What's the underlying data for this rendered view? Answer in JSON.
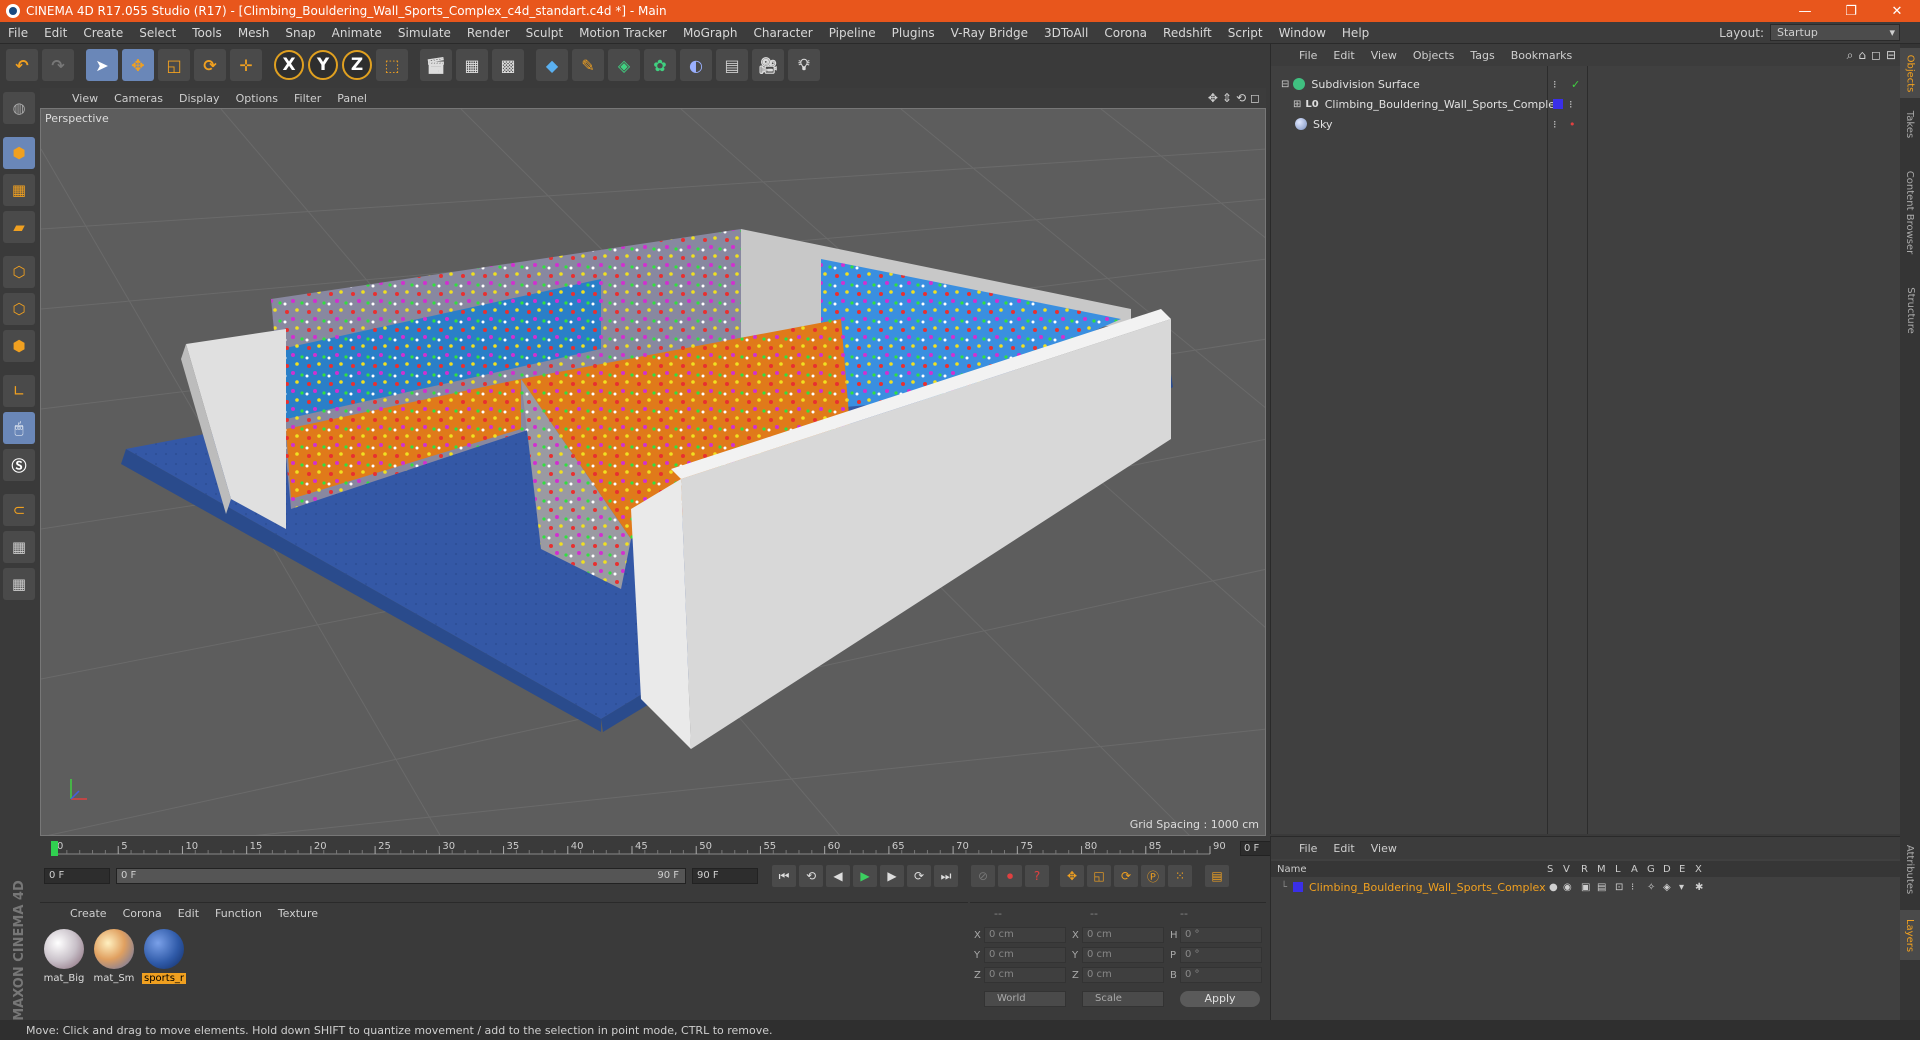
{
  "titlebar": {
    "title": "CINEMA 4D R17.055 Studio (R17) - [Climbing_Bouldering_Wall_Sports_Complex_c4d_standart.c4d *] - Main",
    "minimize": "—",
    "restore": "❐",
    "close": "✕"
  },
  "menu": [
    "File",
    "Edit",
    "Create",
    "Select",
    "Tools",
    "Mesh",
    "Snap",
    "Animate",
    "Simulate",
    "Render",
    "Sculpt",
    "Motion Tracker",
    "MoGraph",
    "Character",
    "Pipeline",
    "Plugins",
    "V-Ray Bridge",
    "3DToAll",
    "Corona",
    "Redshift",
    "Script",
    "Window",
    "Help"
  ],
  "layout": {
    "label": "Layout:",
    "value": "Startup"
  },
  "viewport": {
    "menu": [
      "View",
      "Cameras",
      "Display",
      "Options",
      "Filter",
      "Panel"
    ],
    "label": "Perspective",
    "grid_spacing": "Grid Spacing : 1000 cm"
  },
  "timeline": {
    "ticks": [
      "0",
      "5",
      "10",
      "15",
      "20",
      "25",
      "30",
      "35",
      "40",
      "45",
      "50",
      "55",
      "60",
      "65",
      "70",
      "75",
      "80",
      "85",
      "90"
    ],
    "end_field": "0 F",
    "start": "0 F",
    "range_start": "0 F",
    "range_end": "90 F",
    "end": "90 F"
  },
  "material_manager": {
    "menu": [
      "Create",
      "Corona",
      "Edit",
      "Function",
      "Texture"
    ],
    "materials": [
      {
        "name": "mat_Big"
      },
      {
        "name": "mat_Sm"
      },
      {
        "name": "sports_r"
      }
    ]
  },
  "coordinates": {
    "header": [
      "--",
      "--",
      "--"
    ],
    "rows": [
      {
        "a1": "X",
        "v1": "0 cm",
        "a2": "X",
        "v2": "0 cm",
        "a3": "H",
        "v3": "0 °"
      },
      {
        "a1": "Y",
        "v1": "0 cm",
        "a2": "Y",
        "v2": "0 cm",
        "a3": "P",
        "v3": "0 °"
      },
      {
        "a1": "Z",
        "v1": "0 cm",
        "a2": "Z",
        "v2": "0 cm",
        "a3": "B",
        "v3": "0 °"
      }
    ],
    "mode": "World",
    "scale": "Scale",
    "apply": "Apply"
  },
  "status": "Move: Click and drag to move elements. Hold down SHIFT to quantize movement / add to the selection in point mode, CTRL to remove.",
  "object_manager": {
    "menu": [
      "File",
      "Edit",
      "View",
      "Objects",
      "Tags",
      "Bookmarks"
    ],
    "objects": [
      {
        "name": "Subdivision Surface"
      },
      {
        "name": "Climbing_Bouldering_Wall_Sports_Complex"
      },
      {
        "name": "Sky"
      }
    ]
  },
  "layer_manager": {
    "menu": [
      "File",
      "Edit",
      "View"
    ],
    "columns": [
      "Name",
      "S",
      "V",
      "R",
      "M",
      "L",
      "A",
      "G",
      "D",
      "E",
      "X"
    ],
    "layer": "Climbing_Bouldering_Wall_Sports_Complex"
  },
  "right_tabs": [
    "Objects",
    "Takes",
    "Content Browser",
    "Structure",
    "Attributes",
    "Layers"
  ],
  "colors": {
    "title_bar": "#e8561c",
    "accent": "#f0a020",
    "mat_blue": "#2f5aa8",
    "layer_color": "#3a2fe8"
  }
}
